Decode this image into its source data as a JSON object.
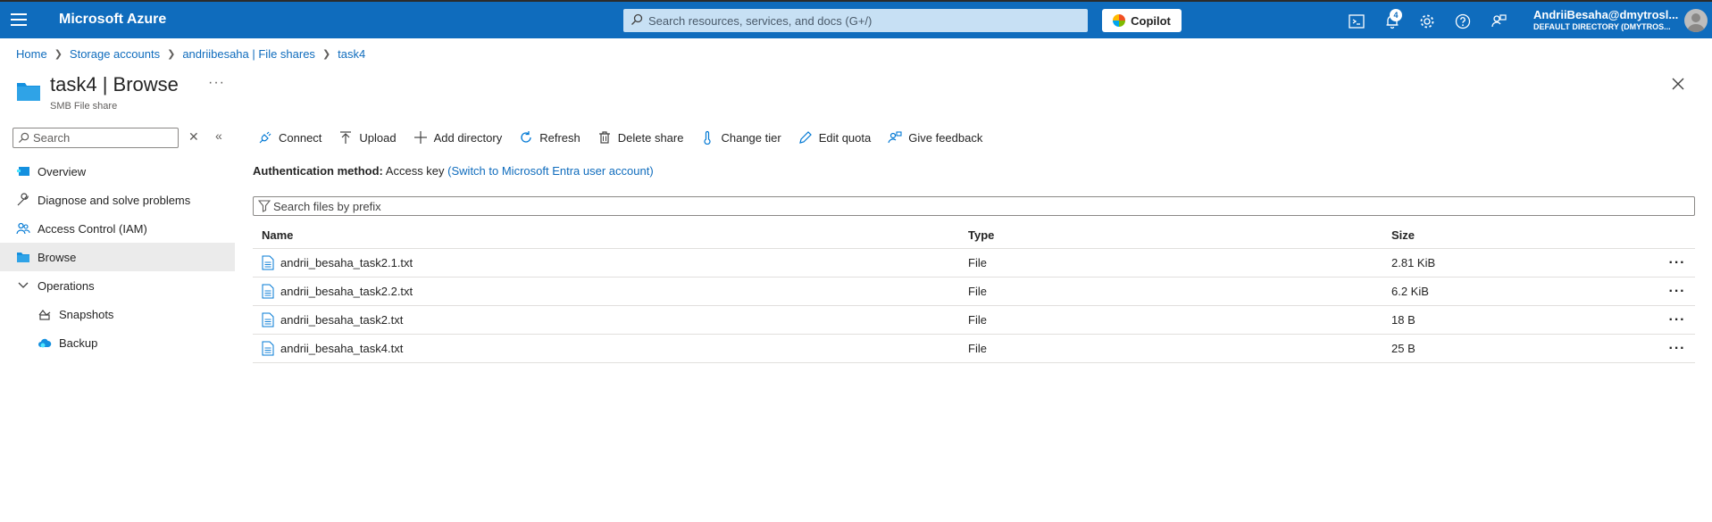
{
  "topbar": {
    "brand": "Microsoft Azure",
    "search_placeholder": "Search resources, services, and docs (G+/)",
    "copilot_label": "Copilot",
    "notification_count": "4",
    "account_name": "AndriiBesaha@dmytrosl...",
    "account_directory": "DEFAULT DIRECTORY (DMYTROS...",
    "accent_color": "#0f6cbd"
  },
  "breadcrumb": {
    "items": [
      "Home",
      "Storage accounts",
      "andriibesaha | File shares",
      "task4"
    ]
  },
  "header": {
    "title_name": "task4",
    "title_section": "Browse",
    "subtitle": "SMB File share",
    "more_label": "···"
  },
  "sidebar": {
    "search_placeholder": "Search",
    "items": [
      {
        "label": "Overview",
        "icon": "overview-icon"
      },
      {
        "label": "Diagnose and solve problems",
        "icon": "wrench-icon"
      },
      {
        "label": "Access Control (IAM)",
        "icon": "people-icon"
      },
      {
        "label": "Browse",
        "icon": "folder-icon"
      },
      {
        "label": "Operations",
        "icon": "chevron-down-icon"
      },
      {
        "label": "Snapshots",
        "icon": "snapshot-icon"
      },
      {
        "label": "Backup",
        "icon": "backup-cloud-icon"
      }
    ]
  },
  "toolbar": {
    "connect": "Connect",
    "upload": "Upload",
    "add_directory": "Add directory",
    "refresh": "Refresh",
    "delete_share": "Delete share",
    "change_tier": "Change tier",
    "edit_quota": "Edit quota",
    "give_feedback": "Give feedback"
  },
  "auth": {
    "label": "Authentication method:",
    "value": "Access key",
    "switch_link": "(Switch to Microsoft Entra user account)"
  },
  "files": {
    "search_placeholder": "Search files by prefix",
    "columns": [
      "Name",
      "Type",
      "Size"
    ],
    "rows": [
      {
        "name": "andrii_besaha_task2.1.txt",
        "type": "File",
        "size": "2.81 KiB"
      },
      {
        "name": "andrii_besaha_task2.2.txt",
        "type": "File",
        "size": "6.2 KiB"
      },
      {
        "name": "andrii_besaha_task2.txt",
        "type": "File",
        "size": "18 B"
      },
      {
        "name": "andrii_besaha_task4.txt",
        "type": "File",
        "size": "25 B"
      }
    ],
    "more_label": "···"
  }
}
